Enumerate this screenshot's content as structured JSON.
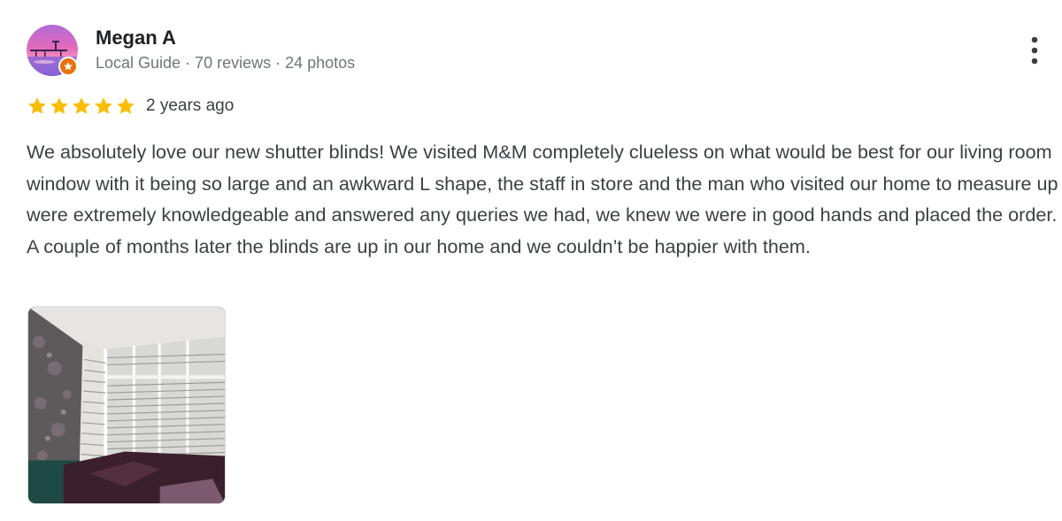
{
  "review": {
    "reviewer": {
      "name": "Megan A",
      "meta": "Local Guide · 70 reviews · 24 photos",
      "avatar_icon": "sunset-pier-avatar",
      "badge_icon": "local-guide-star-icon"
    },
    "rating": 5,
    "max_rating": 5,
    "date": "2 years ago",
    "text": "We absolutely love our new shutter blinds! We visited M&M completely clueless on what would be best for our living room window with it being so large and an awkward L shape, the staff in store and the man who visited our home to measure up were extremely knowledgeable and answered any queries we had, we knew we were in good hands and placed the order. A couple of months later the blinds are up in our home and we couldn’t be happier with them.",
    "photos": [
      {
        "subject": "living-room-shutter-blinds"
      }
    ],
    "more_icon": "more-vertical-icon"
  },
  "colors": {
    "star": "#fbbc04",
    "star_empty": "#dadce0",
    "text": "#3c4043",
    "meta": "#70757a",
    "guide_badge": "#e8710a"
  }
}
